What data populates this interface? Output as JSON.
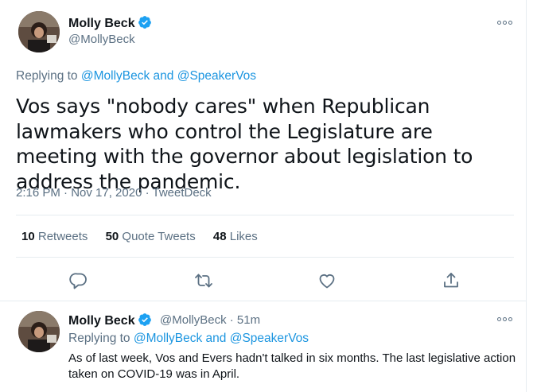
{
  "main_tweet": {
    "author_name": "Molly Beck",
    "handle": "@MollyBeck",
    "replying_prefix": "Replying to",
    "replying_user_1": "@MollyBeck",
    "replying_and": "and",
    "replying_user_2": "@SpeakerVos",
    "text": "Vos says \"nobody cares\" when Republican lawmakers who control the Legislature are meeting with the governor about legislation to address the pandemic.",
    "timestamp": "2:16 PM · Nov 17, 2020 · TweetDeck",
    "retweets_count": "10",
    "retweets_label": "Retweets",
    "quote_tweets_count": "50",
    "quote_tweets_label": "Quote Tweets",
    "likes_count": "48",
    "likes_label": "Likes"
  },
  "reply_tweet": {
    "author_name": "Molly Beck",
    "handle_time": "@MollyBeck · 51m",
    "replying_prefix": "Replying to",
    "replying_user_1": "@MollyBeck",
    "replying_and": "and",
    "replying_user_2": "@SpeakerVos",
    "text": "As of last week, Vos and Evers hadn't talked in six months. The last legislative action taken on COVID-19 was in April."
  },
  "colors": {
    "text": "#0f1419",
    "secondary": "#5b7083",
    "link": "#1b95e0",
    "verified": "#1da1f2",
    "divider": "#e6ecf0"
  }
}
